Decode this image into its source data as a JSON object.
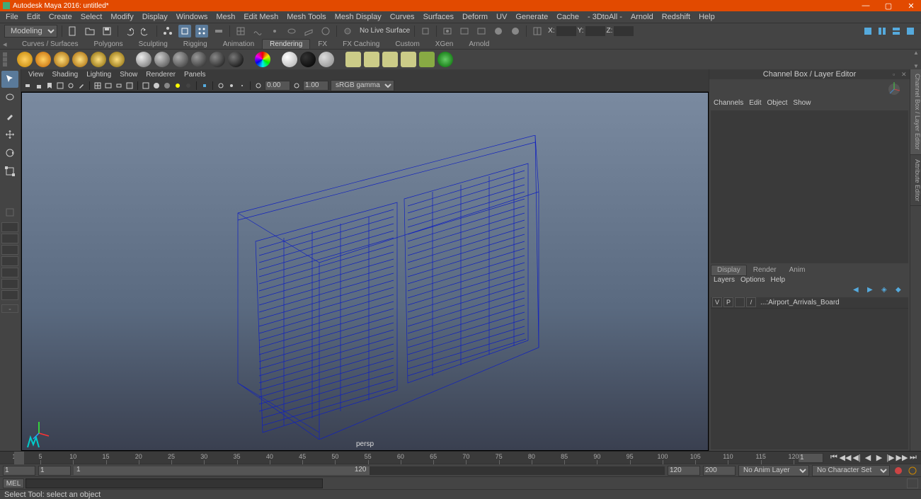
{
  "titlebar": {
    "text": "Autodesk Maya 2016: untitled*"
  },
  "menus": [
    "File",
    "Edit",
    "Create",
    "Select",
    "Modify",
    "Display",
    "Windows",
    "Mesh",
    "Edit Mesh",
    "Mesh Tools",
    "Mesh Display",
    "Curves",
    "Surfaces",
    "Deform",
    "UV",
    "Generate",
    "Cache",
    "- 3DtoAll -",
    "Arnold",
    "Redshift",
    "Help"
  ],
  "workspace": {
    "selector": "Modeling",
    "nolive": "No Live Surface",
    "xyz": {
      "x": "X:",
      "y": "Y:",
      "z": "Z:"
    }
  },
  "shelf_tabs": [
    "Curves / Surfaces",
    "Polygons",
    "Sculpting",
    "Rigging",
    "Animation",
    "Rendering",
    "FX",
    "FX Caching",
    "Custom",
    "XGen",
    "Arnold"
  ],
  "shelf_active": "Rendering",
  "panel_menus": [
    "View",
    "Shading",
    "Lighting",
    "Show",
    "Renderer",
    "Panels"
  ],
  "panel_tools": {
    "exposure": "0.00",
    "gamma": "1.00",
    "colorspace": "sRGB gamma"
  },
  "viewport": {
    "camera": "persp"
  },
  "channelbox": {
    "title": "Channel Box / Layer Editor",
    "menus": [
      "Channels",
      "Edit",
      "Object",
      "Show"
    ]
  },
  "layertabs": [
    "Display",
    "Render",
    "Anim"
  ],
  "layertabs_active": "Display",
  "layermenus": [
    "Layers",
    "Options",
    "Help"
  ],
  "layers": [
    {
      "vis": "V",
      "play": "P",
      "mode": "/",
      "name": "...:Airport_Arrivals_Board"
    }
  ],
  "vert_tabs": [
    "Channel Box / Layer Editor",
    "Attribute Editor"
  ],
  "timeline": {
    "ticks": [
      1,
      5,
      10,
      15,
      20,
      25,
      30,
      35,
      40,
      45,
      50,
      55,
      60,
      65,
      70,
      75,
      80,
      85,
      90,
      95,
      100,
      105,
      110,
      115,
      120
    ],
    "current": "1",
    "range": {
      "start": "1",
      "pstart": "1",
      "pend": "120",
      "end": "120"
    },
    "end_display_start": "1",
    "end_display_end": "120",
    "range_end_a": "120",
    "range_end_b": "200",
    "anim_layer": "No Anim Layer",
    "char_set": "No Character Set"
  },
  "cmd": {
    "lang": "MEL",
    "value": ""
  },
  "help": "Select Tool: select an object"
}
